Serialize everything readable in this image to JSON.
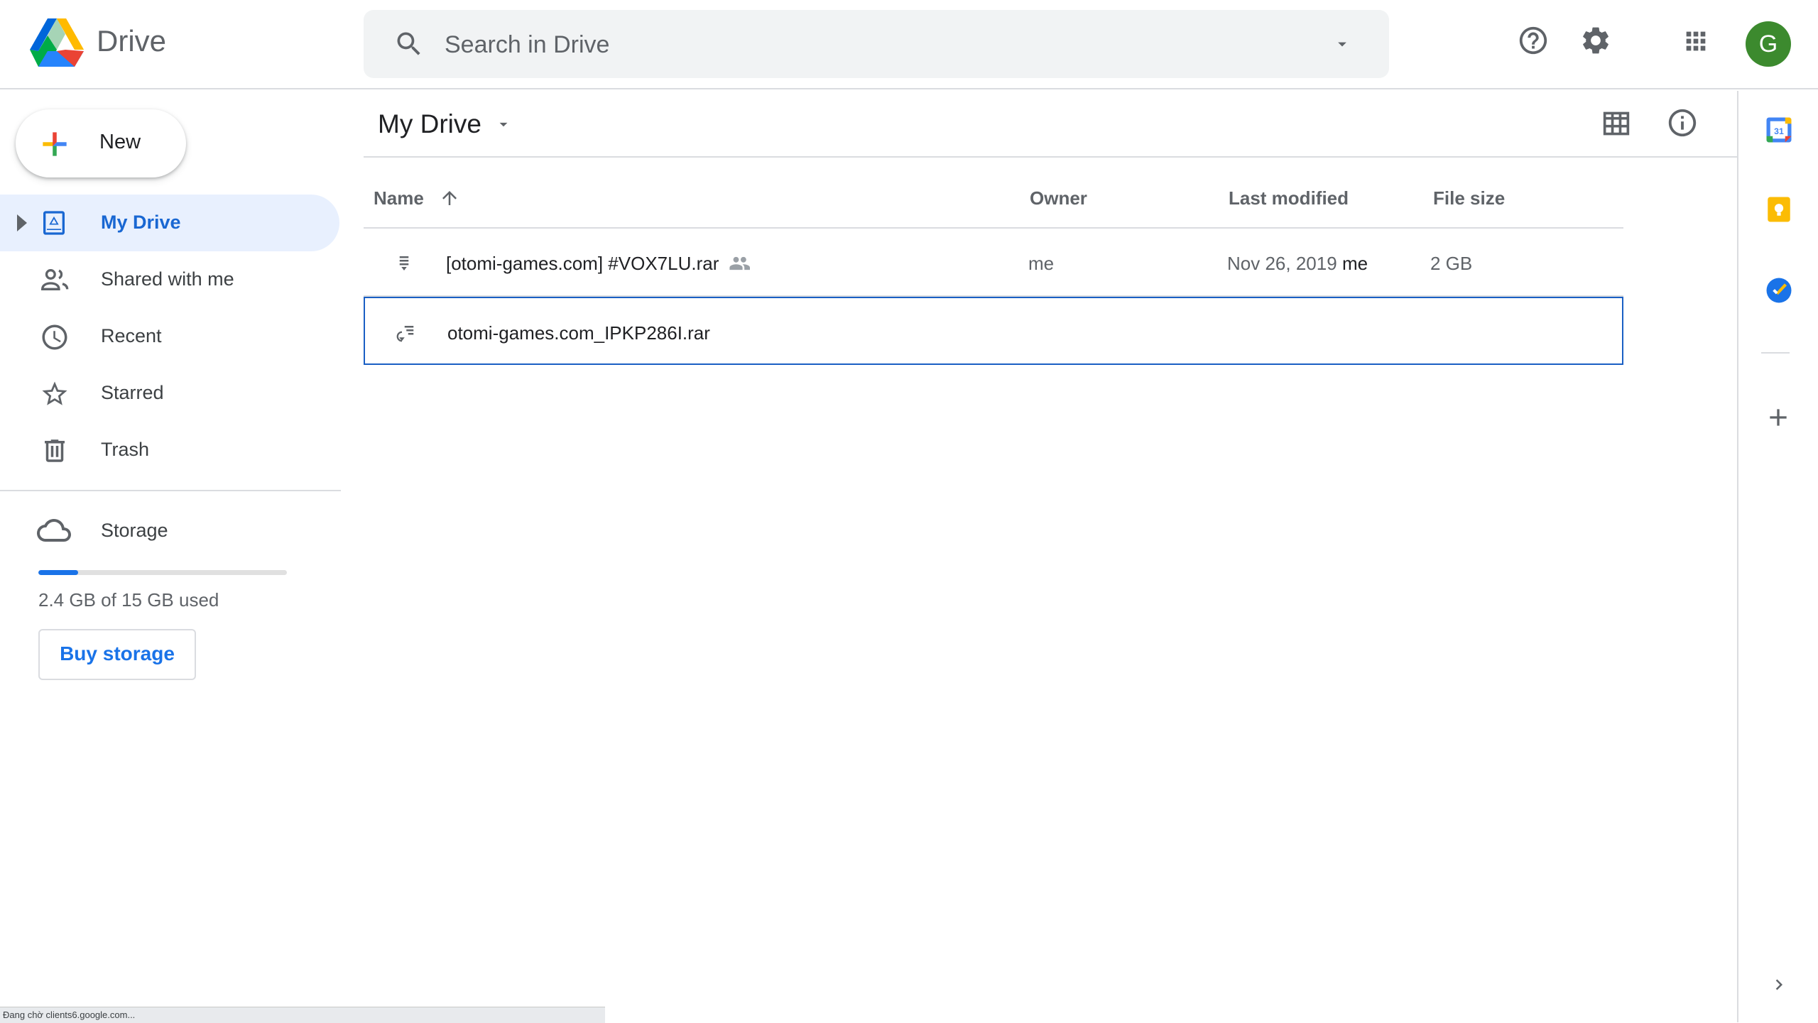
{
  "app": {
    "title": "Drive"
  },
  "search": {
    "placeholder": "Search in Drive",
    "value": ""
  },
  "header": {
    "avatar_letter": "G"
  },
  "new_button": {
    "label": "New"
  },
  "nav": {
    "items": [
      {
        "id": "my-drive",
        "label": "My Drive",
        "active": true
      },
      {
        "id": "shared",
        "label": "Shared with me"
      },
      {
        "id": "recent",
        "label": "Recent"
      },
      {
        "id": "starred",
        "label": "Starred"
      },
      {
        "id": "trash",
        "label": "Trash"
      }
    ]
  },
  "storage": {
    "label": "Storage",
    "used_text": "2.4 GB of 15 GB used",
    "used_fraction": 0.16,
    "buy_label": "Buy storage"
  },
  "main": {
    "title": "My Drive",
    "columns": {
      "name": "Name",
      "owner": "Owner",
      "modified": "Last modified",
      "size": "File size"
    },
    "files": [
      {
        "name": "[otomi-games.com] #VOX7LU.rar",
        "shared": true,
        "owner": "me",
        "modified": "Nov 26, 2019",
        "modified_by": "me",
        "size": "2 GB"
      },
      {
        "name": "otomi-games.com_IPKP286I.rar",
        "selected": true,
        "owner": "",
        "modified": "",
        "modified_by": "",
        "size": ""
      }
    ]
  },
  "side_panel": {
    "apps": [
      "calendar-icon",
      "keep-icon",
      "tasks-icon"
    ],
    "calendar_day": "31"
  },
  "status_bar": {
    "text": "Đang chờ clients6.google.com..."
  },
  "colors": {
    "accent": "#1a73e8",
    "active_bg": "#e8f0fe",
    "avatar": "#3c8a2e"
  }
}
